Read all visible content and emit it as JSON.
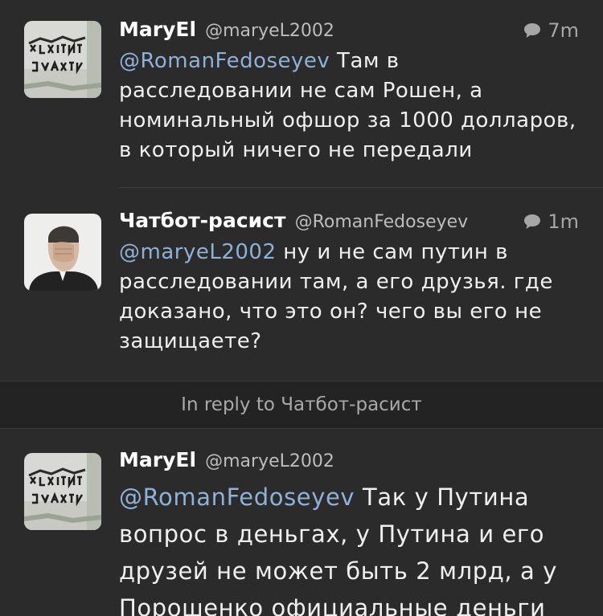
{
  "tweets": [
    {
      "name": "MaryEl",
      "handle": "@maryeL2002",
      "time": "7m",
      "mention": "@RomanFedoseyev",
      "text": " Там в расследовании не сам Рошен, а номинальный офшор за 1000 долларов, в который ничего не передали"
    },
    {
      "name": "Чатбот-расист",
      "handle": "@RomanFedoseyev",
      "time": "1m",
      "mention": "@maryeL2002",
      "text": " ну и не сам путин в расследовании там, а его друзья. где доказано, что это он? чего вы его не защищаете?"
    },
    {
      "name": "MaryEl",
      "handle": "@maryeL2002",
      "mention": "@RomanFedoseyev",
      "text": " Так у Путина вопрос в деньгах, у Путина и его друзей не может быть 2 млрд, а у Порошенко официальные деньги"
    }
  ],
  "reply_bar": {
    "text": "In reply to Чатбот-расист"
  },
  "colors": {
    "background": "#2b2b2b",
    "mention": "#8fb1d8",
    "reply_bar": "#232323"
  },
  "icons": {
    "reply": "speech-bubble-icon",
    "avatar_maryel": "graffiti-wall-avatar",
    "avatar_chatbot": "man-facepalm-avatar"
  }
}
